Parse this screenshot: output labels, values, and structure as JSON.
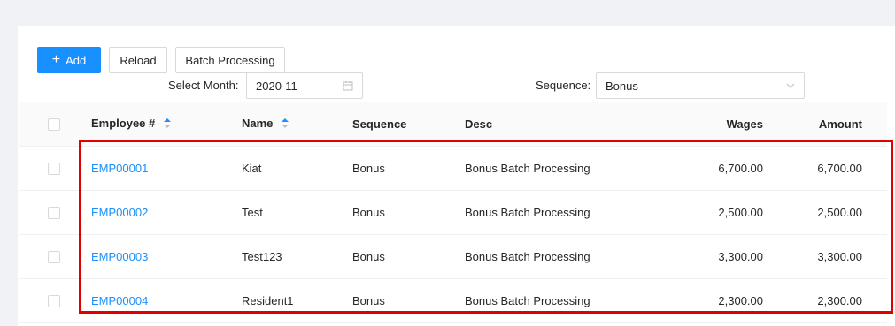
{
  "toolbar": {
    "add_label": "Add",
    "reload_label": "Reload",
    "batch_label": "Batch Processing"
  },
  "filters": {
    "month_label": "Select Month:",
    "month_value": "2020-11",
    "sequence_label": "Sequence:",
    "sequence_value": "Bonus"
  },
  "table": {
    "columns": {
      "employee": "Employee #",
      "name": "Name",
      "sequence": "Sequence",
      "desc": "Desc",
      "wages": "Wages",
      "amount": "Amount"
    },
    "rows": [
      {
        "employee": "EMP00001",
        "name": "Kiat",
        "sequence": "Bonus",
        "desc": "Bonus Batch Processing",
        "wages": "6,700.00",
        "amount": "6,700.00"
      },
      {
        "employee": "EMP00002",
        "name": "Test",
        "sequence": "Bonus",
        "desc": "Bonus Batch Processing",
        "wages": "2,500.00",
        "amount": "2,500.00"
      },
      {
        "employee": "EMP00003",
        "name": "Test123",
        "sequence": "Bonus",
        "desc": "Bonus Batch Processing",
        "wages": "3,300.00",
        "amount": "3,300.00"
      },
      {
        "employee": "EMP00004",
        "name": "Resident1",
        "sequence": "Bonus",
        "desc": "Bonus Batch Processing",
        "wages": "2,300.00",
        "amount": "2,300.00"
      }
    ]
  },
  "colors": {
    "primary": "#1890ff",
    "highlight": "#e00000"
  },
  "icons": {
    "add": "plus-icon",
    "calendar": "calendar-icon",
    "dropdown": "chevron-down-icon",
    "sort": "sort-icon"
  }
}
